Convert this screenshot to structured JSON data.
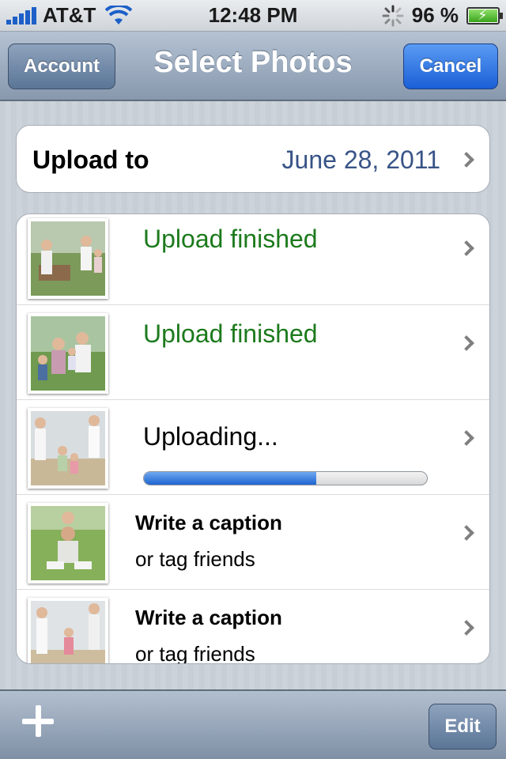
{
  "status_bar": {
    "carrier": "AT&T",
    "time": "12:48 PM",
    "battery": "96 %"
  },
  "nav": {
    "left_button": "Account",
    "title": "Select Photos",
    "right_button": "Cancel"
  },
  "upload_to": {
    "label": "Upload to",
    "value": "June 28, 2011"
  },
  "photos": [
    {
      "status": "Upload finished",
      "state": "finished"
    },
    {
      "status": "Upload finished",
      "state": "finished"
    },
    {
      "status": "Uploading...",
      "state": "uploading",
      "progress": 0.61
    },
    {
      "title": "Write a caption",
      "subtitle": "or tag friends",
      "state": "pending"
    },
    {
      "title": "Write a caption",
      "subtitle": "or tag friends",
      "state": "pending"
    }
  ],
  "toolbar": {
    "add_icon": "plus-icon",
    "edit_label": "Edit"
  },
  "colors": {
    "finished_text": "#1c7a1c",
    "date_text": "#385487",
    "cancel_button": "#1a5fd6"
  }
}
